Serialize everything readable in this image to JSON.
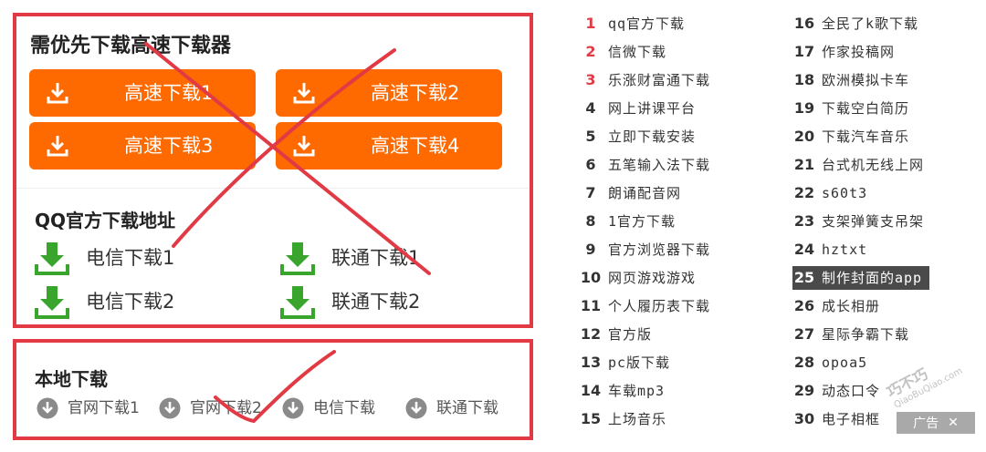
{
  "priority": {
    "heading": "需优先下载高速下载器",
    "buttons": [
      "高速下载1",
      "高速下载2",
      "高速下载3",
      "高速下载4"
    ]
  },
  "qq_official": {
    "heading": "QQ官方下载地址",
    "links": [
      "电信下载1",
      "联通下载1",
      "电信下载2",
      "联通下载2"
    ]
  },
  "local": {
    "heading": "本地下载",
    "links": [
      "官网下载1",
      "官网下载2",
      "电信下载",
      "联通下载"
    ]
  },
  "ranking": {
    "left": [
      {
        "num": "1",
        "text": "qq官方下载"
      },
      {
        "num": "2",
        "text": "信微下载"
      },
      {
        "num": "3",
        "text": "乐涨财富通下载"
      },
      {
        "num": "4",
        "text": "网上讲课平台"
      },
      {
        "num": "5",
        "text": "立即下载安装"
      },
      {
        "num": "6",
        "text": "五笔输入法下载"
      },
      {
        "num": "7",
        "text": "朗诵配音网"
      },
      {
        "num": "8",
        "text": "1官方下载"
      },
      {
        "num": "9",
        "text": "官方浏览器下载"
      },
      {
        "num": "10",
        "text": "网页游戏游戏"
      },
      {
        "num": "11",
        "text": "个人履历表下载"
      },
      {
        "num": "12",
        "text": "官方版"
      },
      {
        "num": "13",
        "text": "pc版下载"
      },
      {
        "num": "14",
        "text": "车载mp3"
      },
      {
        "num": "15",
        "text": "上场音乐"
      }
    ],
    "right": [
      {
        "num": "16",
        "text": "全民了k歌下载"
      },
      {
        "num": "17",
        "text": "作家投稿网"
      },
      {
        "num": "18",
        "text": "欧洲模拟卡车"
      },
      {
        "num": "19",
        "text": "下载空白简历"
      },
      {
        "num": "20",
        "text": "下载汽车音乐"
      },
      {
        "num": "21",
        "text": "台式机无线上网"
      },
      {
        "num": "22",
        "text": "s60t3"
      },
      {
        "num": "23",
        "text": "支架弹簧支吊架"
      },
      {
        "num": "24",
        "text": "hztxt"
      },
      {
        "num": "25",
        "text": "制作封面的app"
      },
      {
        "num": "26",
        "text": "成长相册"
      },
      {
        "num": "27",
        "text": "星际争霸下载"
      },
      {
        "num": "28",
        "text": "opoa5"
      },
      {
        "num": "29",
        "text": "动态口令"
      },
      {
        "num": "30",
        "text": "电子相框"
      }
    ]
  },
  "ad": {
    "label": "广告",
    "close": "✕"
  },
  "watermark": {
    "text": "巧不巧",
    "sub": "QiaoBuQiao.com"
  },
  "colors": {
    "accent": "#ff6a00",
    "annotation_red": "#e23a45",
    "download_green": "#3aa52c",
    "highlight": "#4a4a4a"
  },
  "icons": {
    "button": "download-tray-icon",
    "isp": "green-download-arrow-icon",
    "local": "circle-download-icon"
  }
}
